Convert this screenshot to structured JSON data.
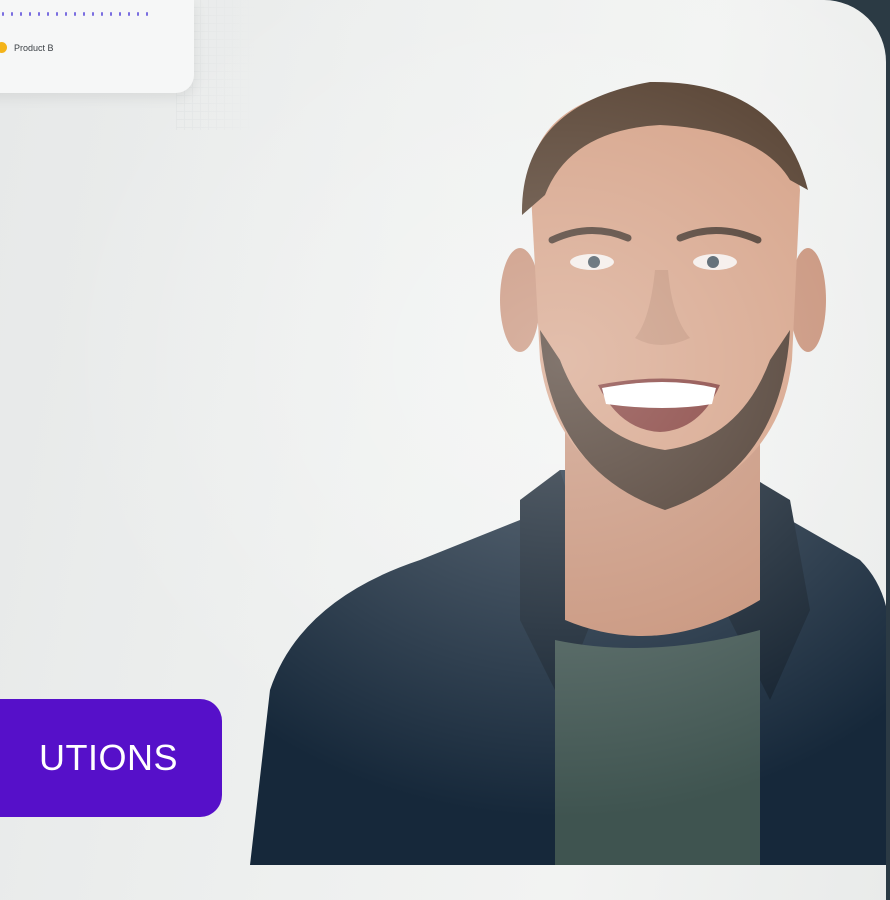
{
  "legend": {
    "items": [
      {
        "label": "Product B",
        "color": "#f4b41a"
      }
    ]
  },
  "cta": {
    "label": "UTIONS",
    "color": "#5610c9"
  },
  "photo": {
    "subject": "smiling-man-portrait"
  }
}
